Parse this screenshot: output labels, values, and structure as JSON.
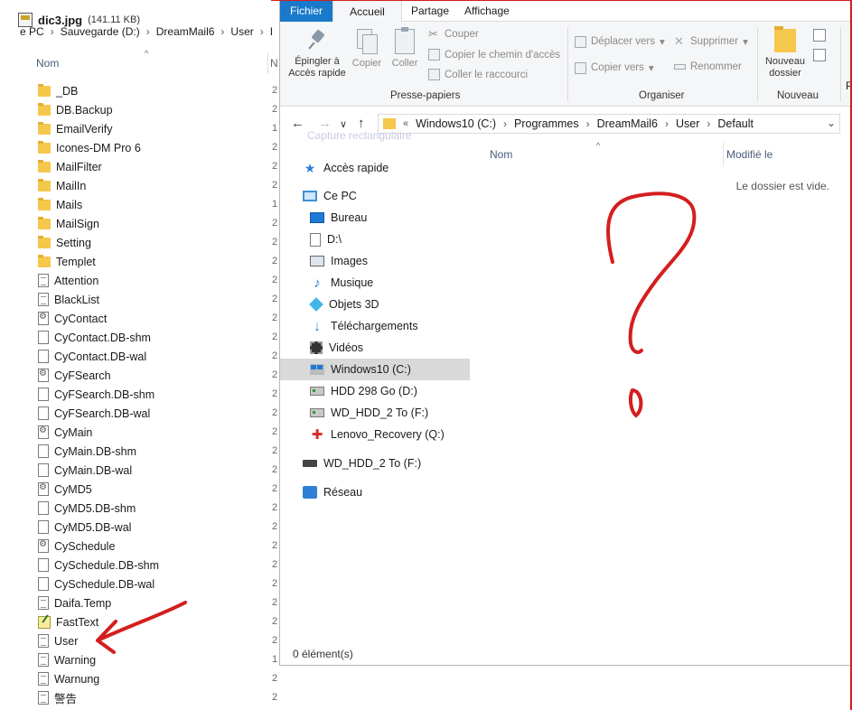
{
  "back_window": {
    "title_file": "dic3.jpg",
    "title_size": "(141.11 KB)",
    "breadcrumb": [
      "e PC",
      "Sauvegarde (D:)",
      "DreamMail6",
      "User",
      "I"
    ],
    "col_name": "Nom",
    "col_next": "N",
    "items": [
      {
        "name": "_DB",
        "icon": "folder-icon",
        "num": "2"
      },
      {
        "name": "DB.Backup",
        "icon": "folder-icon",
        "num": "2"
      },
      {
        "name": "EmailVerify",
        "icon": "folder-icon",
        "num": "1"
      },
      {
        "name": "Icones-DM Pro 6",
        "icon": "folder-icon",
        "num": "2"
      },
      {
        "name": "MailFilter",
        "icon": "folder-icon",
        "num": "2"
      },
      {
        "name": "MailIn",
        "icon": "folder-icon",
        "num": "2"
      },
      {
        "name": "Mails",
        "icon": "folder-icon",
        "num": "1"
      },
      {
        "name": "MailSign",
        "icon": "folder-icon",
        "num": "2"
      },
      {
        "name": "Setting",
        "icon": "folder-icon",
        "num": "2"
      },
      {
        "name": "Templet",
        "icon": "folder-icon",
        "num": "2"
      },
      {
        "name": "Attention",
        "icon": "text-file-icon",
        "num": "2"
      },
      {
        "name": "BlackList",
        "icon": "text-file-icon",
        "num": "2"
      },
      {
        "name": "CyContact",
        "icon": "settings-file-icon",
        "num": "2"
      },
      {
        "name": "CyContact.DB-shm",
        "icon": "blank-file-icon",
        "num": "2"
      },
      {
        "name": "CyContact.DB-wal",
        "icon": "blank-file-icon",
        "num": "2"
      },
      {
        "name": "CyFSearch",
        "icon": "settings-file-icon",
        "num": "2"
      },
      {
        "name": "CyFSearch.DB-shm",
        "icon": "blank-file-icon",
        "num": "2"
      },
      {
        "name": "CyFSearch.DB-wal",
        "icon": "blank-file-icon",
        "num": "2"
      },
      {
        "name": "CyMain",
        "icon": "settings-file-icon",
        "num": "2"
      },
      {
        "name": "CyMain.DB-shm",
        "icon": "blank-file-icon",
        "num": "2"
      },
      {
        "name": "CyMain.DB-wal",
        "icon": "blank-file-icon",
        "num": "2"
      },
      {
        "name": "CyMD5",
        "icon": "settings-file-icon",
        "num": "2"
      },
      {
        "name": "CyMD5.DB-shm",
        "icon": "blank-file-icon",
        "num": "2"
      },
      {
        "name": "CyMD5.DB-wal",
        "icon": "blank-file-icon",
        "num": "2"
      },
      {
        "name": "CySchedule",
        "icon": "settings-file-icon",
        "num": "2"
      },
      {
        "name": "CySchedule.DB-shm",
        "icon": "blank-file-icon",
        "num": "2"
      },
      {
        "name": "CySchedule.DB-wal",
        "icon": "blank-file-icon",
        "num": "2"
      },
      {
        "name": "Daifa.Temp",
        "icon": "text-file-icon",
        "num": "2"
      },
      {
        "name": "FastText",
        "icon": "notepad-file-icon",
        "num": "2"
      },
      {
        "name": "User",
        "icon": "text-file-icon",
        "num": "2"
      },
      {
        "name": "Warning",
        "icon": "text-file-icon",
        "num": "1"
      },
      {
        "name": "Warnung",
        "icon": "text-file-icon",
        "num": "2"
      },
      {
        "name": "警告",
        "icon": "text-file-icon",
        "num": "2"
      }
    ]
  },
  "front_window": {
    "menu": {
      "fichier": "Fichier",
      "accueil": "Accueil",
      "partage": "Partage",
      "affichage": "Affichage"
    },
    "ribbon": {
      "pin_line1": "Épingler à",
      "pin_line2": "Accès rapide",
      "copy": "Copier",
      "paste": "Coller",
      "cut": "Couper",
      "copy_path": "Copier le chemin d'accès",
      "paste_shortcut": "Coller le raccourci",
      "group_clipboard": "Presse-papiers",
      "move_to": "Déplacer vers",
      "copy_to": "Copier vers",
      "delete": "Supprimer",
      "rename": "Renommer",
      "group_organize": "Organiser",
      "new_folder_line1": "Nouveau",
      "new_folder_line2": "dossier",
      "group_new": "Nouveau",
      "cut_off_p": "P"
    },
    "address": {
      "prefix": "«",
      "crumbs": [
        "Windows10 (C:)",
        "Programmes",
        "DreamMail6",
        "User",
        "Default"
      ]
    },
    "ghost_text": "Capture rectangulaire",
    "nav": [
      {
        "label": "Accès rapide",
        "icon": "star-icon",
        "indent": 0
      },
      {
        "label": "Ce PC",
        "icon": "computer-icon",
        "indent": 0
      },
      {
        "label": "Bureau",
        "icon": "desktop-icon",
        "indent": 1
      },
      {
        "label": "D:\\",
        "icon": "document-icon",
        "indent": 1
      },
      {
        "label": "Images",
        "icon": "pictures-icon",
        "indent": 1
      },
      {
        "label": "Musique",
        "icon": "music-icon",
        "indent": 1
      },
      {
        "label": "Objets 3D",
        "icon": "cube-icon",
        "indent": 1
      },
      {
        "label": "Téléchargements",
        "icon": "download-icon",
        "indent": 1
      },
      {
        "label": "Vidéos",
        "icon": "video-icon",
        "indent": 1
      },
      {
        "label": "Windows10 (C:)",
        "icon": "windows-drive-icon",
        "indent": 1,
        "selected": true
      },
      {
        "label": "HDD 298 Go (D:)",
        "icon": "hard-drive-icon",
        "indent": 1
      },
      {
        "label": "WD_HDD_2 To (F:)",
        "icon": "hard-drive-icon",
        "indent": 1
      },
      {
        "label": "Lenovo_Recovery (Q:)",
        "icon": "recovery-drive-icon",
        "indent": 1
      },
      {
        "label": "WD_HDD_2 To (F:)",
        "icon": "usb-drive-icon",
        "indent": 0
      },
      {
        "label": "Réseau",
        "icon": "network-icon",
        "indent": 0
      }
    ],
    "content": {
      "col_name": "Nom",
      "col_modified": "Modifié le",
      "empty_message": "Le dossier est vide."
    },
    "status": "0 élément(s)"
  },
  "colors": {
    "accent_blue": "#1979ca",
    "annotation_red": "#d41e1e",
    "selection_grey": "#d9d9d9",
    "folder_yellow": "#f5c84c"
  }
}
